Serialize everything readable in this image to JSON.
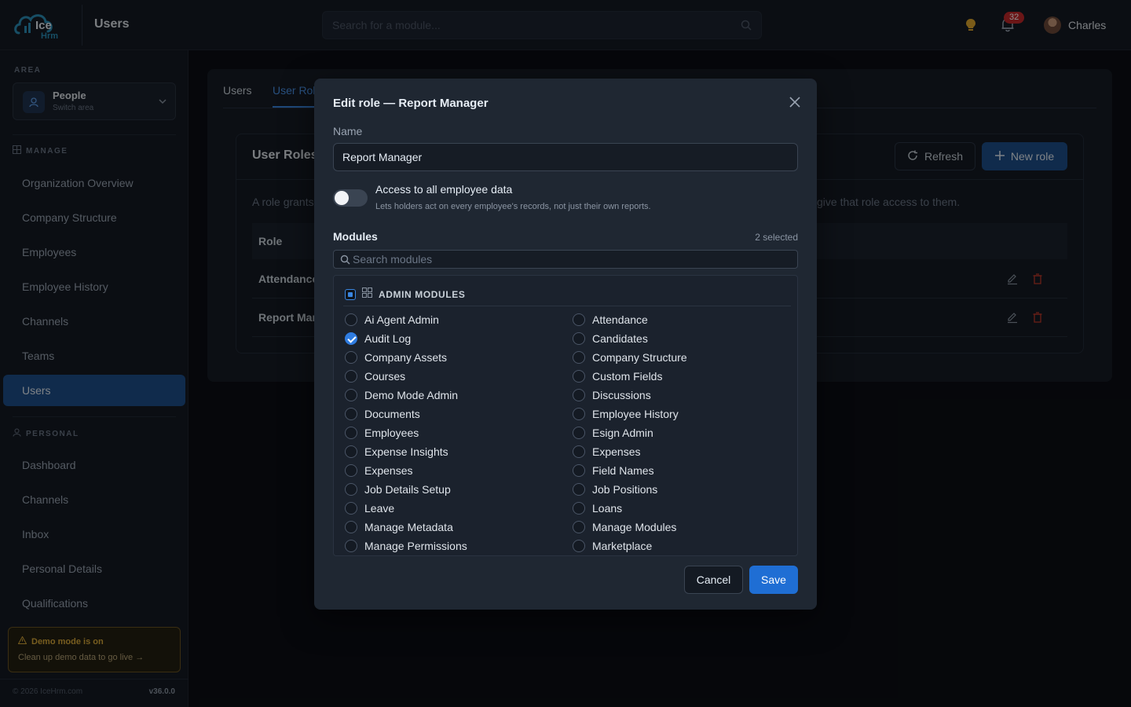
{
  "brand": {
    "logo_text": "Ice",
    "logo_sub": "Hrm"
  },
  "header": {
    "title": "Users",
    "search_placeholder": "Search for a module...",
    "notification_count": "32",
    "user_name": "Charles"
  },
  "sidebar": {
    "area_label": "AREA",
    "area_name": "People",
    "area_sub": "Switch area",
    "manage_label": "MANAGE",
    "manage_items": [
      {
        "label": "Organization Overview"
      },
      {
        "label": "Company Structure"
      },
      {
        "label": "Employees"
      },
      {
        "label": "Employee History"
      },
      {
        "label": "Channels"
      },
      {
        "label": "Teams"
      },
      {
        "label": "Users"
      }
    ],
    "personal_label": "PERSONAL",
    "personal_items": [
      {
        "label": "Dashboard"
      },
      {
        "label": "Channels"
      },
      {
        "label": "Inbox"
      },
      {
        "label": "Personal Details"
      },
      {
        "label": "Qualifications"
      }
    ],
    "demo_title": "Demo mode is on",
    "demo_sub": "Clean up demo data to go live →",
    "copyright": "© 2026 IceHrm.com",
    "version": "v36.0.0"
  },
  "main": {
    "tabs": [
      {
        "label": "Users"
      },
      {
        "label": "User Roles"
      }
    ],
    "card_title": "User Roles",
    "refresh_label": "Refresh",
    "new_role_label": "New role",
    "desc_left": "A role grants",
    "desc_right": "give that role access to them.",
    "col_role": "Role",
    "rows": [
      {
        "role": "Attendance"
      },
      {
        "role": "Report Manager"
      }
    ]
  },
  "modal": {
    "title": "Edit role — Report Manager",
    "name_label": "Name",
    "name_value": "Report Manager",
    "toggle_title": "Access to all employee data",
    "toggle_sub": "Lets holders act on every employee's records, not just their own reports.",
    "toggle_on": false,
    "modules_label": "Modules",
    "selected_count": "2 selected",
    "search_placeholder": "Search modules",
    "group_label": "ADMIN MODULES",
    "left_modules": [
      {
        "label": "Ai Agent Admin",
        "checked": false
      },
      {
        "label": "Audit Log",
        "checked": true
      },
      {
        "label": "Company Assets",
        "checked": false
      },
      {
        "label": "Courses",
        "checked": false
      },
      {
        "label": "Demo Mode Admin",
        "checked": false
      },
      {
        "label": "Documents",
        "checked": false
      },
      {
        "label": "Employees",
        "checked": false
      },
      {
        "label": "Expense Insights",
        "checked": false
      },
      {
        "label": "Expenses",
        "checked": false
      },
      {
        "label": "Job Details Setup",
        "checked": false
      },
      {
        "label": "Leave",
        "checked": false
      },
      {
        "label": "Manage Metadata",
        "checked": false
      },
      {
        "label": "Manage Permissions",
        "checked": false
      }
    ],
    "right_modules": [
      {
        "label": "Attendance",
        "checked": false
      },
      {
        "label": "Candidates",
        "checked": false
      },
      {
        "label": "Company Structure",
        "checked": false
      },
      {
        "label": "Custom Fields",
        "checked": false
      },
      {
        "label": "Discussions",
        "checked": false
      },
      {
        "label": "Employee History",
        "checked": false
      },
      {
        "label": "Esign Admin",
        "checked": false
      },
      {
        "label": "Expenses",
        "checked": false
      },
      {
        "label": "Field Names",
        "checked": false
      },
      {
        "label": "Job Positions",
        "checked": false
      },
      {
        "label": "Loans",
        "checked": false
      },
      {
        "label": "Manage Modules",
        "checked": false
      },
      {
        "label": "Marketplace",
        "checked": false
      }
    ],
    "cancel_label": "Cancel",
    "save_label": "Save"
  },
  "colors": {
    "accent": "#1f6ed4",
    "active_nav": "#1e4f8a",
    "badge": "#c4292b",
    "warning": "#d9a93a",
    "danger": "#c0392b"
  }
}
